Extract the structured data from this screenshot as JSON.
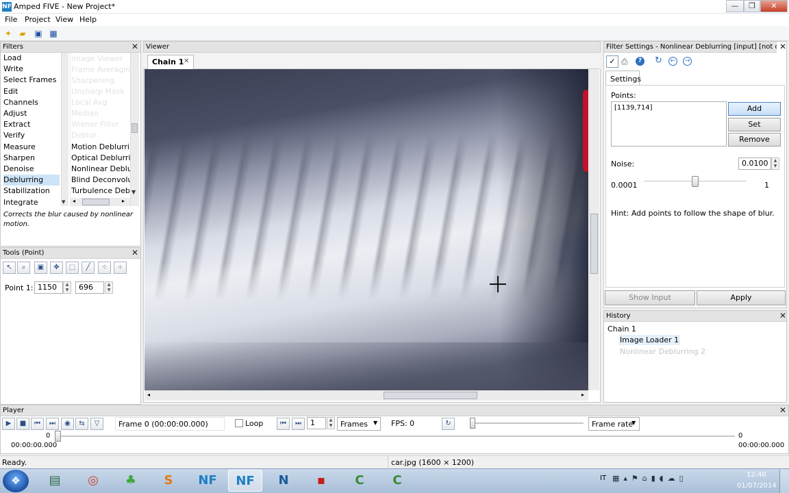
{
  "window": {
    "title": "Amped FIVE - New Project*",
    "logo": "NF",
    "min": "—",
    "max": "❐",
    "close": "✕"
  },
  "menu": [
    "File",
    "Project",
    "View",
    "Help"
  ],
  "toolbar": {
    "icons": [
      "new-project-icon",
      "open-folder-icon",
      "save-icon",
      "save-as-icon"
    ]
  },
  "filters": {
    "title": "Filters",
    "categories": [
      "Load",
      "Write",
      "Select Frames",
      "Edit",
      "Channels",
      "Adjust",
      "Extract",
      "Verify",
      "Measure",
      "Sharpen",
      "Denoise",
      "Deblurring",
      "Stabilization",
      "Integrate"
    ],
    "selected": "Deblurring",
    "sub_items": [
      "Motion Deblurring",
      "Optical Deblurring",
      "Nonlinear Deblurring",
      "Blind Deconvolution",
      "Turbulence Deblurring"
    ],
    "description": "Corrects the blur caused by nonlinear motion."
  },
  "tools": {
    "title": "Tools (Point)",
    "point_label": "Point 1:",
    "x": "1150",
    "y": "696"
  },
  "viewer": {
    "title": "Viewer",
    "tab": "Chain 1",
    "tab_close": "✕"
  },
  "filter_settings": {
    "title": "Filter Settings - Nonlinear Deblurring [input] [not configur...",
    "tab": "Settings",
    "points_label": "Points:",
    "points_value": "[1139,714]",
    "add": "Add",
    "set": "Set",
    "remove": "Remove",
    "noise_label": "Noise:",
    "noise_value": "0.0100",
    "noise_min": "0.0001",
    "noise_max": "1",
    "noise_level": 0.5,
    "hint": "Hint: Add points to follow the shape of blur.",
    "show_input": "Show Input",
    "apply": "Apply"
  },
  "history": {
    "title": "History",
    "chain": "Chain 1",
    "items": [
      "Image Loader 1",
      "Nonlinear Deblurring 2"
    ]
  },
  "player": {
    "title": "Player",
    "frame_text": "Frame 0 (00:00:00.000)",
    "loop": "Loop",
    "step": "1",
    "unit": "Frames",
    "fps": "FPS: 0",
    "rate": "Frame rate",
    "start_frame": "0",
    "start_time": "00:00:00.000",
    "end_frame": "0",
    "end_time": "00:00:00.000"
  },
  "status": {
    "left": "Ready.",
    "file": "car.jpg (1600 × 1200)"
  },
  "taskbar": {
    "lang": "IT",
    "time": "12:40",
    "date": "01/07/2014",
    "apps": [
      "explorer-icon",
      "chrome-icon",
      "clover-icon",
      "sublime-icon",
      "amped-icon",
      "amped-active-icon",
      "amped-alt-icon",
      "pdf-icon",
      "camtasia-icon",
      "camtasia-recorder-icon"
    ]
  },
  "colors": {
    "accent": "#1e7fc4",
    "selection": "#cce4f7",
    "start": "#2b6fc2"
  }
}
